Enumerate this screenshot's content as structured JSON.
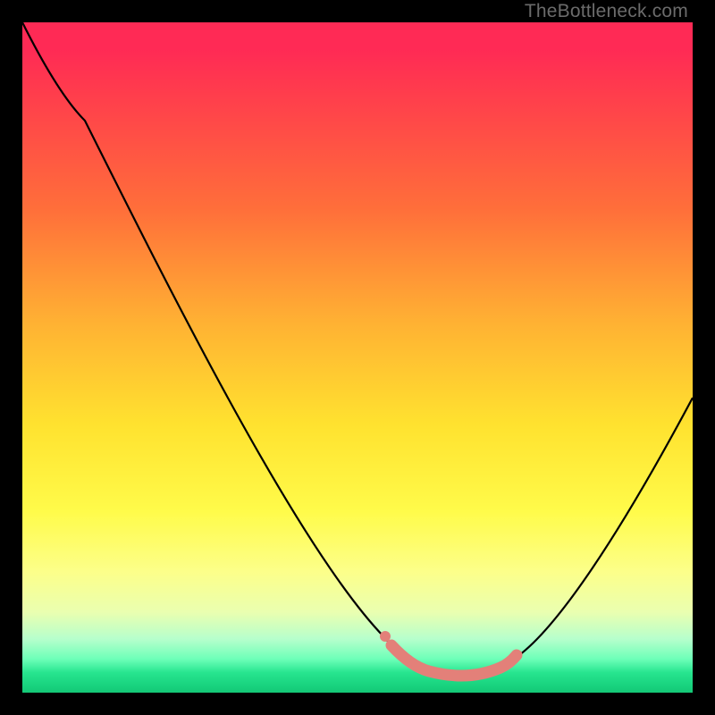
{
  "attribution": "TheBottleneck.com",
  "chart_data": {
    "type": "line",
    "title": "",
    "xlabel": "",
    "ylabel": "",
    "xlim": [
      0,
      100
    ],
    "ylim": [
      0,
      100
    ],
    "grid": false,
    "legend": false,
    "background_gradient": {
      "direction": "vertical",
      "stops": [
        {
          "pos": 0.0,
          "color": "#ff2a55"
        },
        {
          "pos": 0.28,
          "color": "#ff6f3a"
        },
        {
          "pos": 0.6,
          "color": "#ffe22f"
        },
        {
          "pos": 0.82,
          "color": "#fcff8a"
        },
        {
          "pos": 0.95,
          "color": "#6dffb8"
        },
        {
          "pos": 1.0,
          "color": "#14c876"
        }
      ]
    },
    "series": [
      {
        "name": "bottleneck-curve",
        "color": "#000000",
        "x": [
          0,
          5,
          10,
          15,
          20,
          25,
          30,
          35,
          40,
          45,
          50,
          54,
          58,
          62,
          66,
          70,
          75,
          80,
          85,
          90,
          95,
          100
        ],
        "y": [
          100,
          95,
          88,
          80,
          72,
          63,
          54,
          45,
          36,
          27,
          18,
          10,
          5,
          3,
          3,
          4,
          8,
          15,
          25,
          36,
          47,
          57
        ]
      },
      {
        "name": "sweet-spot-highlight",
        "color": "#e38079",
        "x": [
          54,
          56,
          58,
          60,
          62,
          64,
          66,
          68,
          70
        ],
        "y": [
          7,
          4.5,
          3.2,
          2.8,
          2.8,
          3.0,
          3.5,
          5.0,
          8
        ]
      }
    ],
    "annotations": []
  },
  "colors": {
    "curve": "#000000",
    "highlight": "#e38079",
    "attribution": "#6b6b6b",
    "frame": "#000000"
  }
}
